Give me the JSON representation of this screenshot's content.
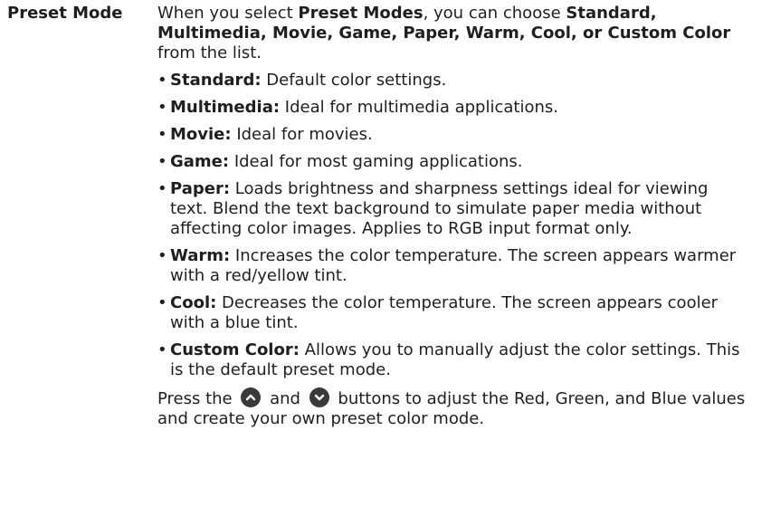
{
  "term": "Preset Mode",
  "intro": {
    "t1": "When you select ",
    "b1": "Preset Modes",
    "t2": ", you can choose ",
    "b2": "Standard, Multimedia, Movie, Game, Paper, Warm, Cool, or Custom Color",
    "t3": " from the list."
  },
  "items": [
    {
      "label": "Standard:",
      "text": " Default color settings."
    },
    {
      "label": "Multimedia:",
      "text": " Ideal for multimedia applications."
    },
    {
      "label": "Movie:",
      "text": " Ideal for movies."
    },
    {
      "label": "Game:",
      "text": " Ideal for most gaming applications."
    },
    {
      "label": "Paper:",
      "text": " Loads brightness and sharpness settings ideal for viewing text. Blend the text background to simulate paper media without affecting color images. Applies to RGB input format only."
    },
    {
      "label": "Warm:",
      "text": " Increases the color temperature. The screen appears warmer with a red/yellow tint."
    },
    {
      "label": "Cool:",
      "text": " Decreases the color temperature. The screen appears cooler with a blue tint."
    },
    {
      "label": "Custom Color:",
      "text": " Allows you to manually adjust the color settings. This is the default preset mode."
    }
  ],
  "outro": {
    "t1": "Press the ",
    "up_icon": "chevron-up-button-icon",
    "t2": " and ",
    "down_icon": "chevron-down-button-icon",
    "t3": " buttons to adjust the Red, Green, and Blue values and create your own preset color mode."
  }
}
